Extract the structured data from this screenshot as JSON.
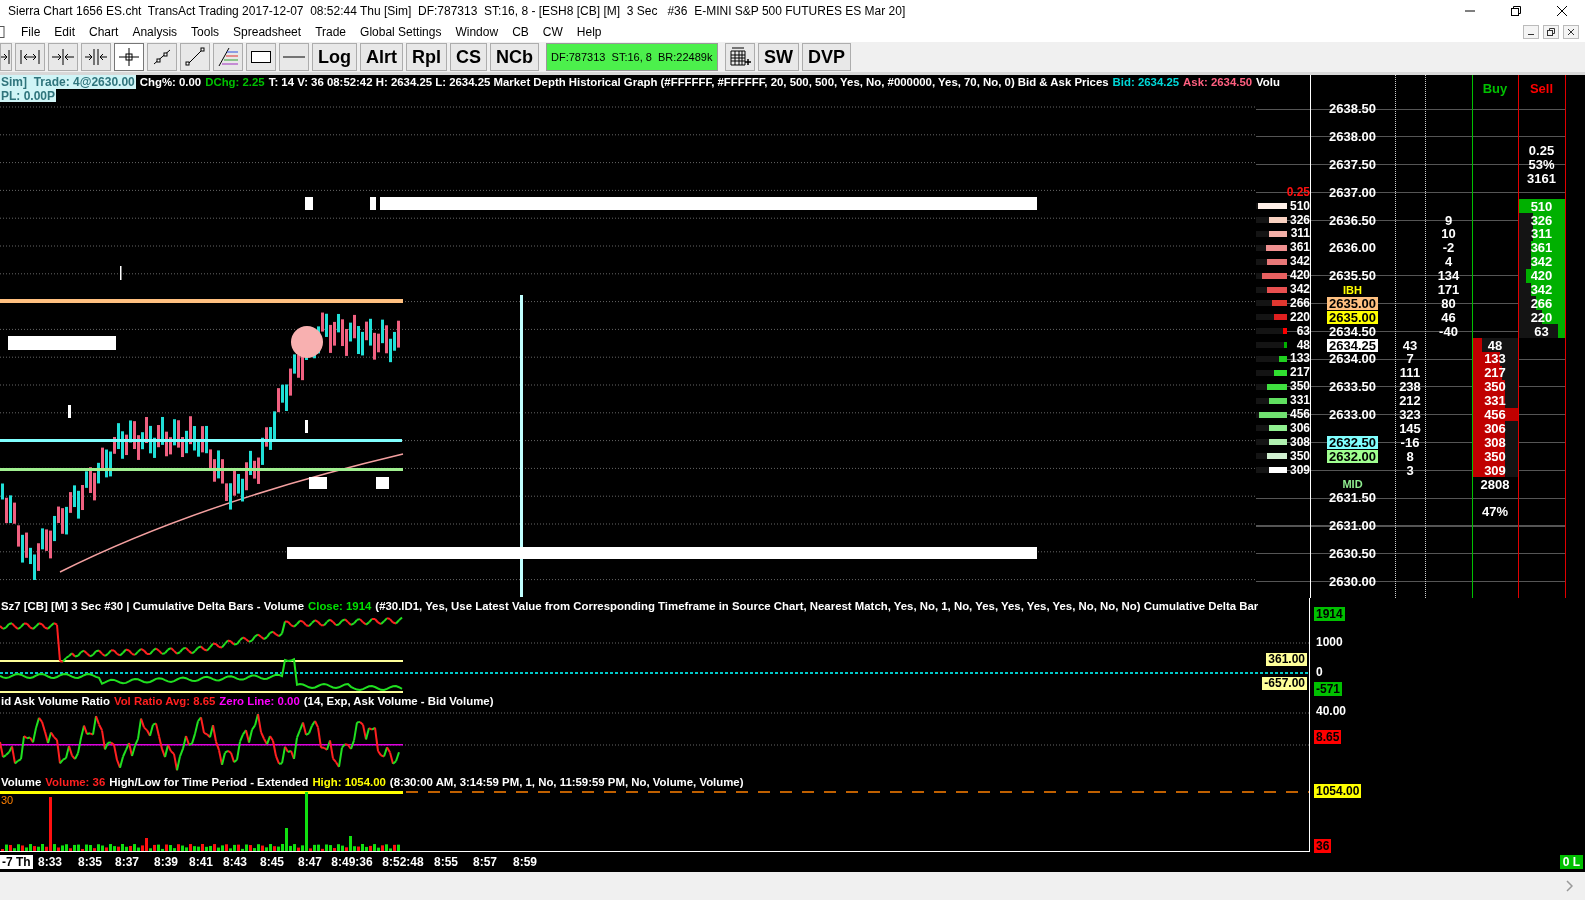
{
  "window": {
    "title": "Sierra Chart 1656 ES.cht  TransAct Trading 2017-12-07  08:52:44 Thu [Sim]  DF:787313  ST:16, 8 - [ESH8 [CB] [M]  3 Sec   #36  E-MINI S&P 500 FUTURES ES Mar 20]"
  },
  "menu": [
    "File",
    "Edit",
    "Chart",
    "Analysis",
    "Tools",
    "Spreadsheet",
    "Trade",
    "Global Settings",
    "Window",
    "CB",
    "CW",
    "Help"
  ],
  "toolbar": {
    "tools": [
      {
        "kind": "bar-end",
        "selected": false
      },
      {
        "kind": "expand",
        "selected": false
      },
      {
        "kind": "compress-in",
        "selected": false
      },
      {
        "kind": "compress-out",
        "selected": false
      },
      {
        "kind": "crosshair",
        "selected": true
      },
      {
        "kind": "ray",
        "selected": false
      },
      {
        "kind": "line",
        "selected": false
      },
      {
        "kind": "fib",
        "selected": false
      },
      {
        "kind": "rectangle",
        "selected": false
      },
      {
        "kind": "hline",
        "selected": false
      }
    ],
    "buttons": [
      "Log",
      "Alrt",
      "Rpl",
      "CS",
      "NCb"
    ],
    "status": "DF:787313  ST:16, 8  BR:22489k",
    "buttons_right": [
      "SW",
      "DVP"
    ]
  },
  "main_chart": {
    "trade_info": [
      "Sim]  Trade: 4@2630.00",
      "PL: 0.00P"
    ],
    "header": [
      {
        "text": "Chg%: 0.00",
        "color": "#ffffff"
      },
      {
        "text": "DChg: 2.25",
        "color": "#00c000"
      },
      {
        "text": "T: 14 V: 36 08:52:42 H: 2634.25 L: 2634.25  Market Depth Historical Graph   (#FFFFFF, #FFFFFF, 20, 500, 500, Yes, No, #000000, Yes, 70, No, 0)  Bid & Ask Prices",
        "color": "#ffffff"
      },
      {
        "text": "Bid: 2634.25",
        "color": "#00d8d8"
      },
      {
        "text": "Ask: 2634.50",
        "color": "#ff6080"
      },
      {
        "text": "Volu",
        "color": "#ffffff"
      }
    ]
  },
  "ladder": {
    "buy_header": "Buy",
    "sell_header": "Sell",
    "rows": [
      {
        "price": "2638.50"
      },
      {},
      {
        "price": "2638.00"
      },
      {
        "sell_note": "0.25"
      },
      {
        "price": "2637.50",
        "sell_note": "53%"
      },
      {
        "sell_note": "3161"
      },
      {
        "price": "2637.00",
        "depth_note": "0.25"
      },
      {
        "depth": {
          "value": "510",
          "level": 0.95,
          "color": "#fff0e8"
        },
        "sell": {
          "value": "510",
          "level": 1.0
        }
      },
      {
        "price": "2636.50",
        "depth": {
          "value": "326",
          "level": 0.6,
          "color": "#f8d0c0"
        },
        "ask_delta": "9",
        "sell": {
          "value": "326",
          "level": 0.7
        }
      },
      {
        "depth": {
          "value": "311",
          "level": 0.58,
          "color": "#f4b0a8"
        },
        "ask_delta": "10",
        "sell": {
          "value": "311",
          "level": 0.7
        }
      },
      {
        "price": "2636.00",
        "depth": {
          "value": "361",
          "level": 0.68,
          "color": "#f09090"
        },
        "ask_delta": "-2",
        "sell": {
          "value": "361",
          "level": 0.75
        }
      },
      {
        "depth": {
          "value": "342",
          "level": 0.64,
          "color": "#e87878"
        },
        "ask_delta": "4",
        "sell": {
          "value": "342",
          "level": 0.75
        }
      },
      {
        "price": "2635.50",
        "depth": {
          "value": "420",
          "level": 0.8,
          "color": "#e86060"
        },
        "ask_delta": "134",
        "sell": {
          "value": "420",
          "level": 0.85
        }
      },
      {
        "marker": {
          "text": "IBH",
          "color": "#ffff00"
        },
        "depth": {
          "value": "342",
          "level": 0.64,
          "color": "#e85050"
        },
        "ask_delta": "171",
        "sell": {
          "value": "342",
          "level": 0.75
        }
      },
      {
        "price": "2635.00",
        "tag": {
          "color": "#ffc080"
        },
        "depth": {
          "value": "266",
          "level": 0.5,
          "color": "#e03830"
        },
        "ask_delta": "80",
        "sell": {
          "value": "266",
          "level": 0.62
        }
      },
      {
        "price": "2635.00",
        "tag": {
          "color": "#ffff00"
        },
        "depth": {
          "value": "220",
          "level": 0.42,
          "color": "#e02020"
        },
        "ask_delta": "46",
        "sell": {
          "value": "220",
          "level": 0.5
        }
      },
      {
        "price": "2634.50",
        "depth": {
          "value": "63",
          "level": 0.15,
          "color": "#ff0000"
        },
        "ask_delta": "-40",
        "sell": {
          "value": "63",
          "level": 0.15
        }
      },
      {
        "price": "2634.25",
        "tag": {
          "color": "#ffffff"
        },
        "depth": {
          "value": "48",
          "level": 0.12,
          "color": "#00b000"
        },
        "bid_delta": "43",
        "buy": {
          "value": "48",
          "level": 0.2
        }
      },
      {
        "price": "2634.00",
        "depth": {
          "value": "133",
          "level": 0.28,
          "color": "#20d020"
        },
        "bid_delta": "7",
        "buy": {
          "value": "133",
          "level": 0.6
        }
      },
      {
        "depth": {
          "value": "217",
          "level": 0.42,
          "color": "#30e030"
        },
        "bid_delta": "111",
        "buy": {
          "value": "217",
          "level": 0.65
        }
      },
      {
        "price": "2633.50",
        "depth": {
          "value": "350",
          "level": 0.66,
          "color": "#40e040"
        },
        "bid_delta": "238",
        "buy": {
          "value": "350",
          "level": 0.72
        }
      },
      {
        "depth": {
          "value": "331",
          "level": 0.6,
          "color": "#60e060"
        },
        "bid_delta": "212",
        "buy": {
          "value": "331",
          "level": 0.7
        }
      },
      {
        "price": "2633.00",
        "depth": {
          "value": "456",
          "level": 0.9,
          "color": "#70e070"
        },
        "bid_delta": "323",
        "buy": {
          "value": "456",
          "level": 1.0
        }
      },
      {
        "depth": {
          "value": "306",
          "level": 0.58,
          "color": "#90f090"
        },
        "bid_delta": "145",
        "buy": {
          "value": "306",
          "level": 0.7
        }
      },
      {
        "price": "2632.50",
        "tag": {
          "color": "#80ffff"
        },
        "depth": {
          "value": "308",
          "level": 0.58,
          "color": "#b0f0b0"
        },
        "bid_delta": "-16",
        "buy": {
          "value": "308",
          "level": 0.7
        }
      },
      {
        "price": "2632.00",
        "tag": {
          "color": "#a0ff90"
        },
        "depth": {
          "value": "350",
          "level": 0.64,
          "color": "#d0f0d0"
        },
        "bid_delta": "8",
        "buy": {
          "value": "350",
          "level": 0.72
        }
      },
      {
        "depth": {
          "value": "309",
          "level": 0.58,
          "color": "#ffffff"
        },
        "bid_delta": "3",
        "buy": {
          "value": "309",
          "level": 0.7
        }
      },
      {
        "marker": {
          "text": "MID",
          "color": "#90ee90"
        },
        "buy_note": "2808"
      },
      {
        "price": "2631.50"
      },
      {
        "buy_note": "47%"
      },
      {
        "price": "2631.00"
      },
      {},
      {
        "price": "2630.50"
      },
      {},
      {
        "price": "2630.00"
      }
    ]
  },
  "delta_panel": {
    "header": [
      {
        "text": "Sz7 [CB] [M]  3 Sec   #30 | Cumulative Delta Bars - Volume",
        "color": "#ffffff"
      },
      {
        "text": "Close: 1914",
        "color": "#00e000"
      },
      {
        "text": "(#30.ID1, Yes, Use Latest Value from Corresponding Timeframe in Source Chart, Nearest Match, Yes, No, 1, No, Yes, Yes, Yes, Yes, No, No, No)  Cumulative Delta Bar",
        "color": "#ffffff"
      }
    ],
    "plot_tags": [
      {
        "text": "361.00",
        "color": "#ffff99"
      },
      {
        "text": "-657.00",
        "color": "#ffff99"
      }
    ],
    "axis": [
      {
        "text": "1914",
        "color": "#00c000"
      },
      {
        "text": "1000"
      },
      {
        "text": "0"
      },
      {
        "text": "-571",
        "color": "#00c000"
      }
    ]
  },
  "ratio_panel": {
    "header": [
      {
        "text": "id Ask Volume Ratio",
        "color": "#ffffff"
      },
      {
        "text": "Vol Ratio Avg: 8.65",
        "color": "#ff2020"
      },
      {
        "text": "Zero Line: 0.00",
        "color": "#ff00ff"
      },
      {
        "text": "(14, Exp, Ask Volume - Bid Volume)",
        "color": "#ffffff"
      }
    ],
    "axis": [
      {
        "text": "40.00"
      },
      {
        "text": "8.65",
        "color": "#ff0000"
      }
    ]
  },
  "volume_panel": {
    "header": [
      {
        "text": "Volume",
        "color": "#ffffff"
      },
      {
        "text": "Volume: 36",
        "color": "#ff2020"
      },
      {
        "text": "High/Low for Time Period - Extended",
        "color": "#ffffff"
      },
      {
        "text": "High: 1054.00",
        "color": "#ffff00"
      },
      {
        "text": "(8:30:00 AM, 3:14:59 PM, 1, No, 11:59:59 PM, No, Volume, Volume)",
        "color": "#ffffff"
      }
    ],
    "corner_label": "30",
    "axis": [
      {
        "text": "1054.00",
        "color": "#ffff00"
      },
      {
        "text": "36",
        "color": "#ff0000"
      }
    ]
  },
  "time_axis": [
    {
      "text": "-7 Th",
      "kind": "date"
    },
    {
      "text": "8:33",
      "kind": "time"
    },
    {
      "text": "8:35",
      "kind": "time"
    },
    {
      "text": "8:37",
      "kind": "time"
    },
    {
      "text": "8:39",
      "kind": "time"
    },
    {
      "text": "8:41",
      "kind": "time"
    },
    {
      "text": "8:43",
      "kind": "time"
    },
    {
      "text": "8:45",
      "kind": "time"
    },
    {
      "text": "8:47",
      "kind": "time"
    },
    {
      "text": "8:49:36",
      "kind": "time"
    },
    {
      "text": "8:52:48",
      "kind": "time"
    },
    {
      "text": "8:55",
      "kind": "time"
    },
    {
      "text": "8:57",
      "kind": "time"
    },
    {
      "text": "8:59",
      "kind": "time"
    }
  ],
  "status_tag": "0 L"
}
